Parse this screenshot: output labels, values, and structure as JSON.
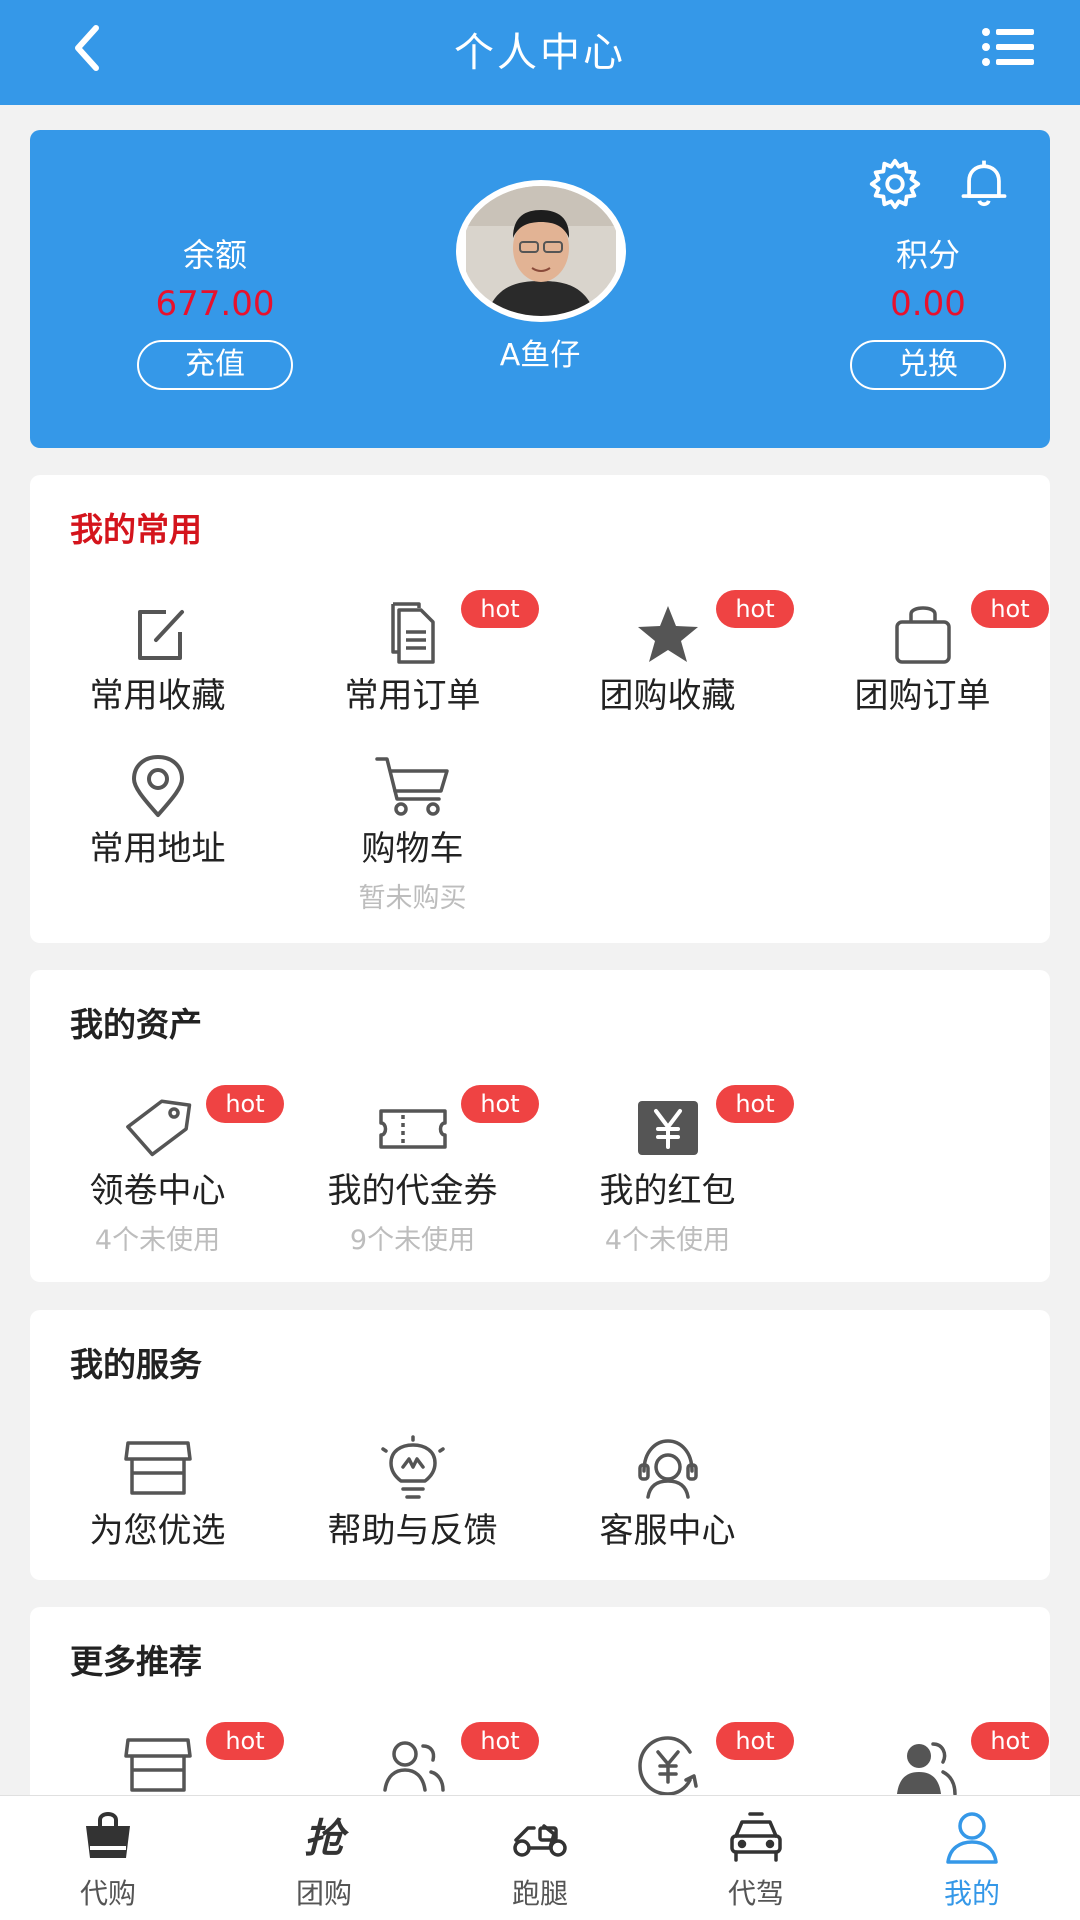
{
  "header": {
    "title": "个人中心",
    "back_icon": "chevron-left-icon",
    "menu_icon": "list-icon"
  },
  "profile": {
    "balance_label": "余额",
    "balance_value": "677.00",
    "recharge_label": "充值",
    "points_label": "积分",
    "points_value": "0.00",
    "exchange_label": "兑换",
    "username": "A鱼仔"
  },
  "sections": {
    "common": {
      "title": "我的常用",
      "items": [
        {
          "label": "常用收藏",
          "icon": "edit-icon",
          "hot": ""
        },
        {
          "label": "常用订单",
          "icon": "document-icon",
          "hot": "hot"
        },
        {
          "label": "团购收藏",
          "icon": "star-icon",
          "hot": "hot"
        },
        {
          "label": "团购订单",
          "icon": "bag-icon",
          "hot": "hot"
        },
        {
          "label": "常用地址",
          "icon": "location-icon",
          "hot": ""
        },
        {
          "label": "购物车",
          "icon": "cart-icon",
          "hot": "",
          "sub": "暂未购买"
        }
      ]
    },
    "assets": {
      "title": "我的资产",
      "items": [
        {
          "label": "领卷中心",
          "icon": "tag-icon",
          "hot": "hot",
          "sub": "4个未使用"
        },
        {
          "label": "我的代金券",
          "icon": "ticket-icon",
          "hot": "hot",
          "sub": "9个未使用"
        },
        {
          "label": "我的红包",
          "icon": "yen-icon",
          "hot": "hot",
          "sub": "4个未使用"
        }
      ]
    },
    "services": {
      "title": "我的服务",
      "items": [
        {
          "label": "为您优选",
          "icon": "store-icon"
        },
        {
          "label": "帮助与反馈",
          "icon": "bulb-icon"
        },
        {
          "label": "客服中心",
          "icon": "headset-icon"
        }
      ]
    },
    "more": {
      "title": "更多推荐",
      "items": [
        {
          "icon": "store-icon",
          "hot": "hot"
        },
        {
          "icon": "users-icon",
          "hot": "hot"
        },
        {
          "icon": "yen-exchange-icon",
          "hot": "hot"
        },
        {
          "icon": "users-solid-icon",
          "hot": "hot"
        }
      ]
    }
  },
  "tabbar": [
    {
      "label": "代购",
      "icon": "basket-icon"
    },
    {
      "label": "团购",
      "icon": "grab-icon",
      "glyph": "抢"
    },
    {
      "label": "跑腿",
      "icon": "scooter-icon"
    },
    {
      "label": "代驾",
      "icon": "car-icon"
    },
    {
      "label": "我的",
      "icon": "user-icon",
      "active": true
    }
  ],
  "colors": {
    "primary": "#3598e8",
    "red_value": "#e8112d",
    "hot": "#ef4343",
    "title_red": "#d4141c"
  }
}
